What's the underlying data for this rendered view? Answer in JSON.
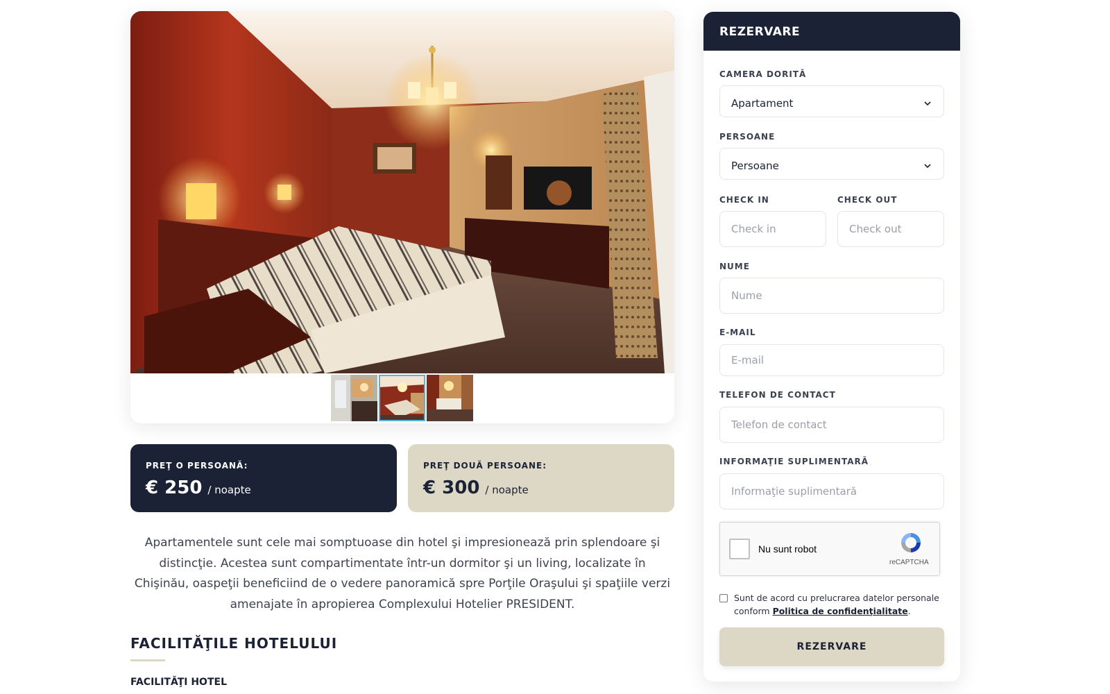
{
  "pricing": {
    "single": {
      "label": "PREŢ O PERSOANĂ:",
      "amount": "€ 250",
      "unit": "/ noapte"
    },
    "double": {
      "label": "PREŢ DOUĂ PERSOANE:",
      "amount": "€ 300",
      "unit": "/ noapte"
    }
  },
  "description": "Apartamentele sunt cele mai somptuoase din hotel şi impresionează prin splendoare şi distincţie. Acestea sunt compartimentate într-un dormitor şi un living, localizate în Chişinău, oaspeţii beneficiind de o vedere panoramică spre Porţile Oraşului şi spaţiile verzi amenajate în apropierea Complexului Hotelier PRESIDENT.",
  "facilities": {
    "title": "FACILITĂŢILE HOTELULUI",
    "subtitle": "FACILITĂŢI HOTEL"
  },
  "gallery": {
    "thumbnails": [
      {
        "name": "bathroom",
        "active": false
      },
      {
        "name": "bedroom",
        "active": true
      },
      {
        "name": "living-room",
        "active": false
      }
    ]
  },
  "booking": {
    "header": "REZERVARE",
    "room": {
      "label": "CAMERA DORITĂ",
      "value": "Apartament"
    },
    "persons": {
      "label": "PERSOANE",
      "value": "Persoane"
    },
    "checkin": {
      "label": "CHECK IN",
      "placeholder": "Check in"
    },
    "checkout": {
      "label": "CHECK OUT",
      "placeholder": "Check out"
    },
    "name": {
      "label": "NUME",
      "placeholder": "Nume"
    },
    "email": {
      "label": "E-MAIL",
      "placeholder": "E-mail"
    },
    "phone": {
      "label": "TELEFON DE CONTACT",
      "placeholder": "Telefon de contact"
    },
    "info": {
      "label": "INFORMAŢIE SUPLIMENTARĂ",
      "placeholder": "Informaţie suplimentară"
    },
    "captcha": {
      "text": "Nu sunt robot",
      "brand": "reCAPTCHA"
    },
    "consent": {
      "text": "Sunt de acord cu prelucrarea datelor personale conform ",
      "link": "Politica de confidenţialitate",
      "end": "."
    },
    "submit": "REZERVARE"
  },
  "colors": {
    "navy": "#1b2236",
    "beige": "#ddd7c6",
    "thumbnail_active": "#58b4d8"
  },
  "icons": [
    "chevron-down-icon",
    "recaptcha-icon"
  ]
}
